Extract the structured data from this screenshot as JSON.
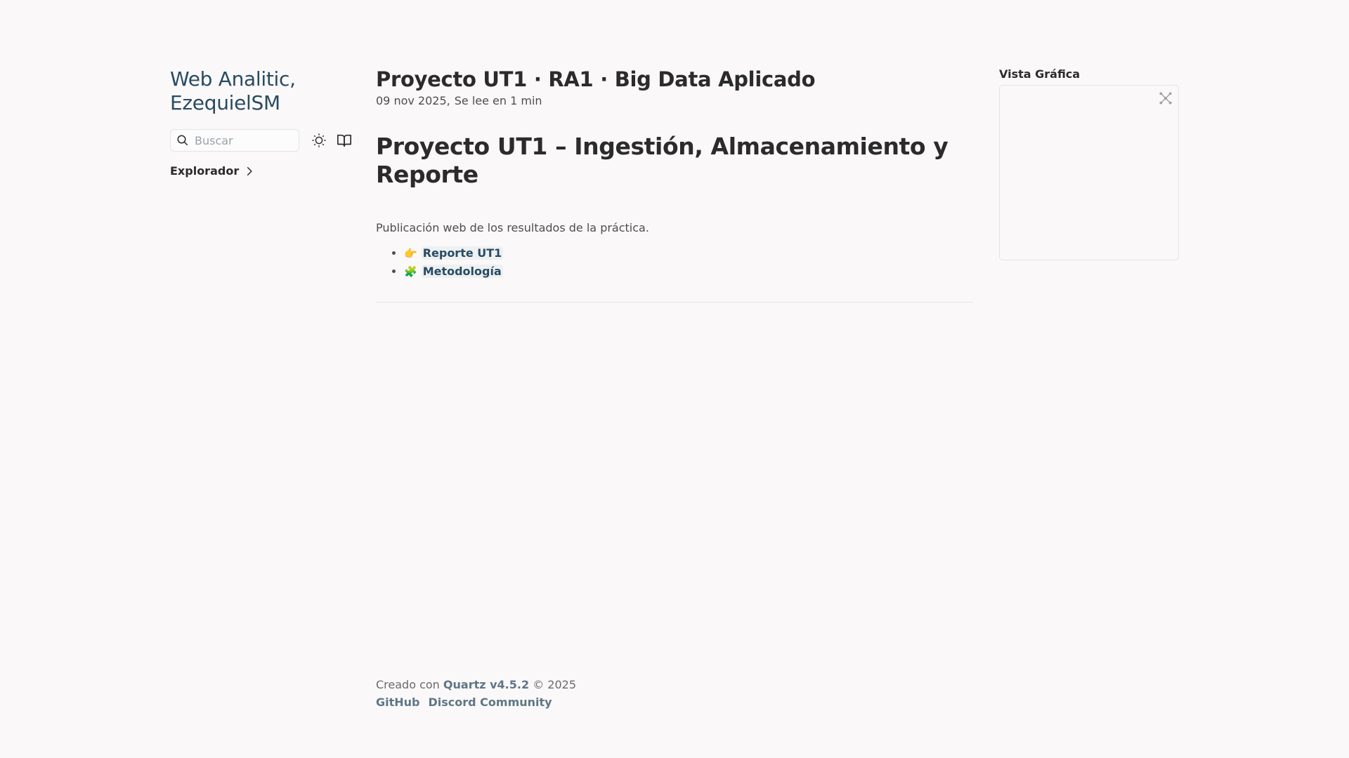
{
  "sidebar": {
    "site_title_line1": "Web Analitic,",
    "site_title_line2": "EzequielSM",
    "search_placeholder": "Buscar",
    "explorer_label": "Explorador"
  },
  "article": {
    "title": "Proyecto UT1 · RA1 · Big Data Aplicado",
    "date": "09 nov 2025,",
    "reading_time": "Se lee en 1 min",
    "heading": "Proyecto UT1 – Ingestión, Almacenamiento y Reporte",
    "intro": "Publicación web de los resultados de la práctica.",
    "links": [
      {
        "emoji": "👉",
        "label": "Reporte UT1"
      },
      {
        "emoji": "🧩",
        "label": "Metodología"
      }
    ]
  },
  "graph": {
    "title": "Vista Gráfica"
  },
  "footer": {
    "created_prefix": "Creado con",
    "quartz_label": "Quartz v4.5.2",
    "copyright": "© 2025",
    "github_label": "GitHub",
    "discord_label": "Discord Community"
  },
  "colors": {
    "accent": "#284b63",
    "background": "#faf8f8",
    "text": "#2b2b2b"
  }
}
